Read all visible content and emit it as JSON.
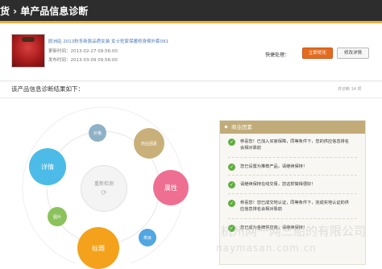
{
  "header": {
    "title": "货 › 单产品信息诊断"
  },
  "product": {
    "name": "欧洲站 2013秋冬新款品质女装 女士驼家保暖修身棉外套091",
    "updated": "更新时间：2013-02-27 09:56:00",
    "created": "发布时间：2013-03-09 09:56:00"
  },
  "actions": {
    "quick_label": "快捷处理：",
    "optimize_label": "立即优化",
    "edit_label": "修改详情"
  },
  "result": {
    "title": "该产品信息诊断结果如下：",
    "count": "共诊断 14 项"
  },
  "diagram": {
    "center_label": "重新检测",
    "bubbles": {
      "detail": "详情",
      "price": "价格",
      "sku": "商业因素",
      "attr": "属性",
      "img": "图片",
      "cat": "类目",
      "title": "标题"
    },
    "colors": {
      "detail": "#4cbbe8",
      "price": "#8fb1c6",
      "sku": "#c9b07a",
      "attr": "#ee6f92",
      "img": "#8cc25c",
      "cat": "#52a6e1",
      "title": "#f4a21b"
    }
  },
  "tips": {
    "heading": "商业因素",
    "items": [
      "恭喜您！已加入买家保障，同等条件下，您的供应信息排名会相对靠前",
      "您已设置为推荐产品，请继续保持！",
      "请继续保持在线交易，您这样做得很好！",
      "恭喜您！您已成交地认证，同等条件下，完成实地认证的供应信息排名会相对靠前",
      "您已成为金牌供应商，请继续保持！"
    ]
  },
  "watermark": {
    "line1": "杭州网一网三船的有限公司",
    "line2": "naymasan.com.cn"
  }
}
